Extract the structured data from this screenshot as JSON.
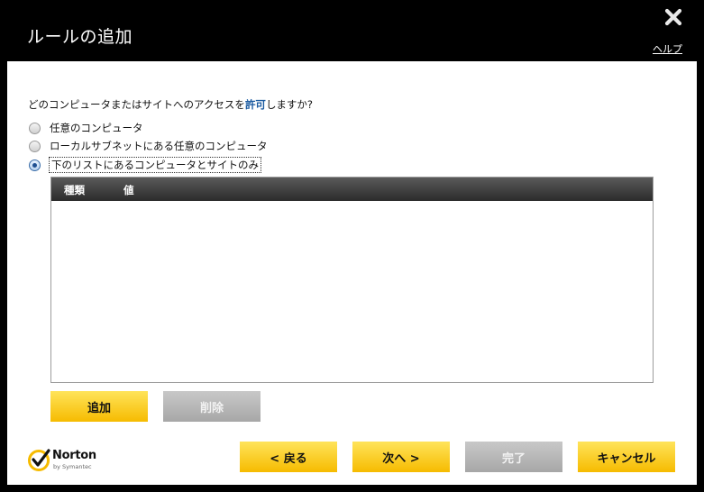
{
  "window": {
    "title": "ルールの追加",
    "help_label": "ヘルプ"
  },
  "question": {
    "prefix": "どのコンピュータまたはサイトへのアクセスを",
    "emphasis": "許可",
    "suffix": "しますか?"
  },
  "options": [
    {
      "label": "任意のコンピュータ",
      "checked": false
    },
    {
      "label": "ローカルサブネットにある任意のコンピュータ",
      "checked": false
    },
    {
      "label": "下のリストにあるコンピュータとサイトのみ",
      "checked": true
    }
  ],
  "list": {
    "columns": [
      "種類",
      "値"
    ],
    "rows": []
  },
  "list_buttons": {
    "add_label": "追加",
    "remove_label": "削除"
  },
  "footer": {
    "back_label": "< 戻る",
    "next_label": "次へ >",
    "finish_label": "完了",
    "cancel_label": "キャンセル"
  },
  "logo": {
    "brand": "Norton",
    "sub": "by Symantec"
  },
  "colors": {
    "accent_yellow": "#f6bb00",
    "link_blue": "#1a5aa0",
    "disabled_gray": "#a7a7a7"
  }
}
